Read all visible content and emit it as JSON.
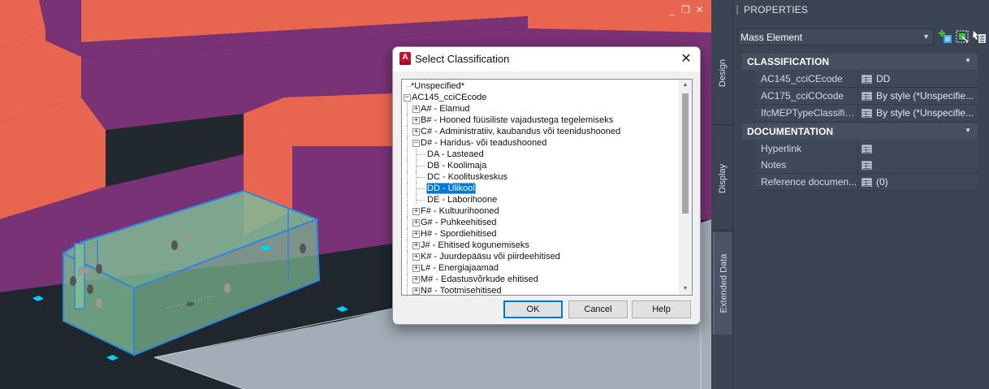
{
  "viewport": {
    "controls": [
      "_",
      "❐",
      "✕"
    ],
    "colors": {
      "background": "#212830",
      "wall_side": "#e8664f",
      "wall_top": "#7a3276",
      "mass_element": "#7fba92",
      "grip": "#00d0ff"
    }
  },
  "palette": {
    "title": "PROPERTIES",
    "tabs": [
      "Design",
      "Display",
      "Extended Data"
    ],
    "object_type": "Mass Element",
    "sections": [
      {
        "header": "CLASSIFICATION",
        "rows": [
          {
            "key": "AC145_cciCEcode",
            "value": "DD"
          },
          {
            "key": "AC175_cciCOcode",
            "value": "By style (*Unspecifie..."
          },
          {
            "key": "IfcMEPTypeClassific...",
            "value": "By style (*Unspecifie..."
          }
        ]
      },
      {
        "header": "DOCUMENTATION",
        "rows": [
          {
            "key": "Hyperlink",
            "value": ""
          },
          {
            "key": "Notes",
            "value": ""
          },
          {
            "key": "Reference documen...",
            "value": "(0)"
          }
        ]
      }
    ]
  },
  "dialog": {
    "title": "Select Classification",
    "tree": [
      {
        "label": "*Unspecified*",
        "level": 0,
        "expander": ""
      },
      {
        "label": "AC145_cciCEcode",
        "level": 0,
        "expander": "-"
      },
      {
        "label": "A# - Elamud",
        "level": 1,
        "expander": "+"
      },
      {
        "label": "B# - Hooned füüsiliste vajadustega tegelemiseks",
        "level": 1,
        "expander": "+"
      },
      {
        "label": "C# - Administratiiv, kaubandus või teenidushooned",
        "level": 1,
        "expander": "+"
      },
      {
        "label": "D# - Haridus- või teadushooned",
        "level": 1,
        "expander": "-"
      },
      {
        "label": "DA - Lasteaed",
        "level": 2,
        "expander": ""
      },
      {
        "label": "DB - Koolimaja",
        "level": 2,
        "expander": ""
      },
      {
        "label": "DC - Koolituskeskus",
        "level": 2,
        "expander": ""
      },
      {
        "label": "DD - Ülikool",
        "level": 2,
        "expander": "",
        "selected": true
      },
      {
        "label": "DE - Laborihoone",
        "level": 2,
        "expander": ""
      },
      {
        "label": "F# - Kultuurihooned",
        "level": 1,
        "expander": "+"
      },
      {
        "label": "G# - Puhkeehitised",
        "level": 1,
        "expander": "+"
      },
      {
        "label": "H# - Spordiehitised",
        "level": 1,
        "expander": "+"
      },
      {
        "label": "J# - Ehitised kogunemiseks",
        "level": 1,
        "expander": "+"
      },
      {
        "label": "K# - Juurdepääsu või piirdeehitised",
        "level": 1,
        "expander": "+"
      },
      {
        "label": "L# - Energiajaamad",
        "level": 1,
        "expander": "+"
      },
      {
        "label": "M# - Edastusvõrkude ehitised",
        "level": 1,
        "expander": "+"
      },
      {
        "label": "N# - Tootmisehitised",
        "level": 1,
        "expander": "+"
      }
    ],
    "ok_label": "OK",
    "cancel_label": "Cancel",
    "help_label": "Help",
    "selection_color": "#0078d7"
  }
}
